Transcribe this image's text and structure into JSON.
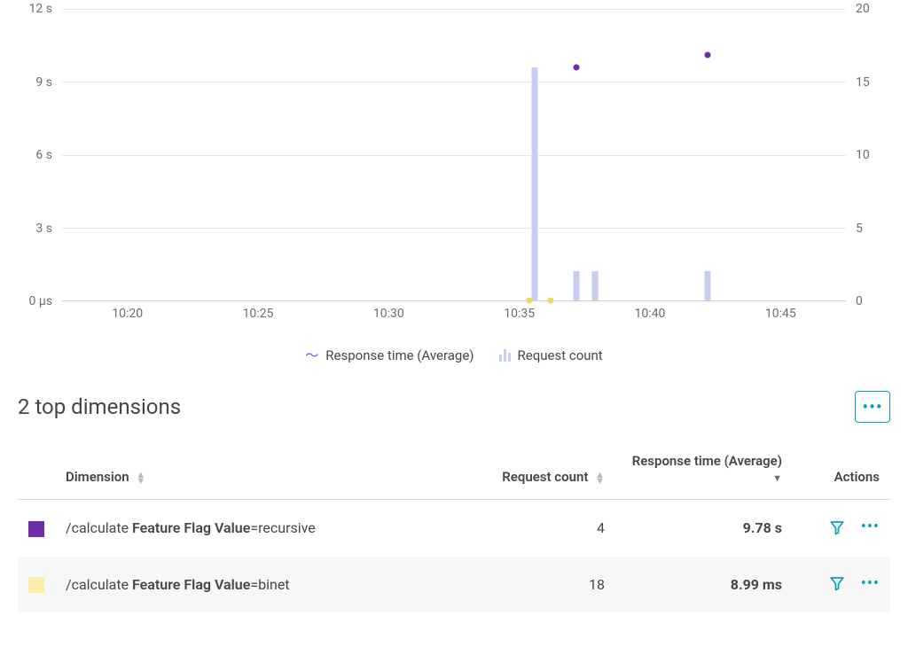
{
  "chart_data": {
    "type": "combo",
    "title": "",
    "x_axis": {
      "label": "",
      "ticks": [
        "10:20",
        "10:25",
        "10:30",
        "10:35",
        "10:40",
        "10:45"
      ],
      "range_minutes": [
        17.5,
        47.5
      ]
    },
    "y_axis_left": {
      "label": "",
      "ticks": [
        "0 μs",
        "3 s",
        "6 s",
        "9 s",
        "12 s"
      ],
      "range": [
        0,
        12
      ]
    },
    "y_axis_right": {
      "label": "",
      "ticks": [
        "0",
        "5",
        "10",
        "15",
        "20"
      ],
      "range": [
        0,
        20
      ]
    },
    "bar_series": {
      "name": "Request count",
      "axis": "right",
      "points": [
        {
          "x_minute": 35.6,
          "value": 16
        },
        {
          "x_minute": 37.2,
          "value": 2
        },
        {
          "x_minute": 37.9,
          "value": 2
        },
        {
          "x_minute": 42.2,
          "value": 2
        }
      ]
    },
    "scatter_series": [
      {
        "name": "recursive",
        "color": "#6f2da8",
        "axis": "left",
        "points": [
          {
            "x_minute": 37.2,
            "value": 9.6
          },
          {
            "x_minute": 42.2,
            "value": 10.1
          }
        ]
      },
      {
        "name": "binet",
        "color": "#f0d860",
        "axis": "left",
        "points": [
          {
            "x_minute": 35.4,
            "value": 0
          },
          {
            "x_minute": 36.2,
            "value": 0
          }
        ]
      }
    ],
    "legend": [
      {
        "type": "line",
        "label": "Response time (Average)"
      },
      {
        "type": "bar",
        "label": "Request count"
      }
    ]
  },
  "section": {
    "title": "2 top dimensions"
  },
  "table": {
    "columns": {
      "dimension": "Dimension",
      "request_count": "Request count",
      "response_time": "Response time (Average)",
      "actions": "Actions"
    },
    "rows": [
      {
        "swatch_color": "#6f2da8",
        "dimension_prefix": "/calculate ",
        "dimension_bold": "Feature Flag Value",
        "dimension_suffix": "=recursive",
        "request_count": "4",
        "response_time": "9.78 s"
      },
      {
        "swatch_color": "#fbeeac",
        "dimension_prefix": "/calculate ",
        "dimension_bold": "Feature Flag Value",
        "dimension_suffix": "=binet",
        "request_count": "18",
        "response_time": "8.99 ms"
      }
    ]
  }
}
